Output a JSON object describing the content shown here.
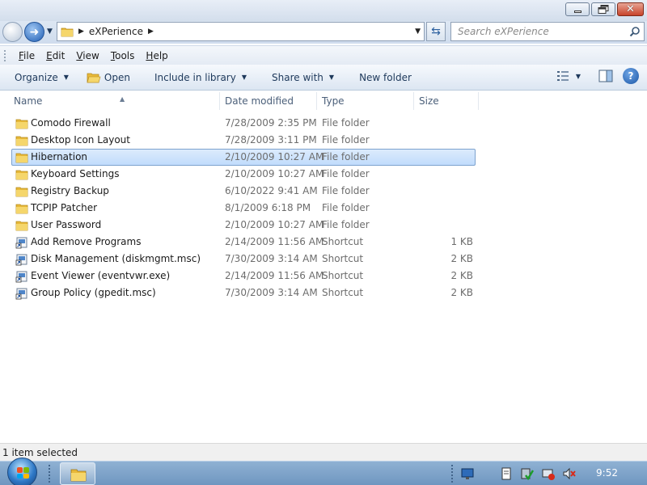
{
  "window": {
    "buttons": {
      "minimize": "minimize",
      "maximize": "maximize",
      "close": "close"
    }
  },
  "address": {
    "path": [
      "eXPerience"
    ],
    "search_placeholder": "Search eXPerience"
  },
  "menu": {
    "items": [
      {
        "label": "File",
        "underline": "F",
        "rest": "ile"
      },
      {
        "label": "Edit",
        "underline": "E",
        "rest": "dit"
      },
      {
        "label": "View",
        "underline": "V",
        "rest": "iew"
      },
      {
        "label": "Tools",
        "underline": "T",
        "rest": "ools"
      },
      {
        "label": "Help",
        "underline": "H",
        "rest": "elp"
      }
    ]
  },
  "commands": {
    "organize": "Organize",
    "open": "Open",
    "include_in_library": "Include in library",
    "share_with": "Share with",
    "new_folder": "New folder"
  },
  "columns": {
    "name": "Name",
    "date_modified": "Date modified",
    "type": "Type",
    "size": "Size"
  },
  "files": [
    {
      "name": "Comodo Firewall",
      "date": "7/28/2009 2:35 PM",
      "type": "File folder",
      "size": "",
      "icon": "folder-icon",
      "selected": false
    },
    {
      "name": "Desktop Icon Layout",
      "date": "7/28/2009 3:11 PM",
      "type": "File folder",
      "size": "",
      "icon": "folder-icon",
      "selected": false
    },
    {
      "name": "Hibernation",
      "date": "2/10/2009 10:27 AM",
      "type": "File folder",
      "size": "",
      "icon": "folder-icon",
      "selected": true
    },
    {
      "name": "Keyboard Settings",
      "date": "2/10/2009 10:27 AM",
      "type": "File folder",
      "size": "",
      "icon": "folder-icon",
      "selected": false
    },
    {
      "name": "Registry Backup",
      "date": "6/10/2022 9:41 AM",
      "type": "File folder",
      "size": "",
      "icon": "folder-icon",
      "selected": false
    },
    {
      "name": "TCPIP Patcher",
      "date": "8/1/2009 6:18 PM",
      "type": "File folder",
      "size": "",
      "icon": "folder-icon",
      "selected": false
    },
    {
      "name": "User Password",
      "date": "2/10/2009 10:27 AM",
      "type": "File folder",
      "size": "",
      "icon": "folder-icon",
      "selected": false
    },
    {
      "name": "Add Remove Programs",
      "date": "2/14/2009 11:56 AM",
      "type": "Shortcut",
      "size": "1 KB",
      "icon": "shortcut-icon",
      "selected": false
    },
    {
      "name": "Disk Management (diskmgmt.msc)",
      "date": "7/30/2009 3:14 AM",
      "type": "Shortcut",
      "size": "2 KB",
      "icon": "shortcut-icon",
      "selected": false
    },
    {
      "name": "Event Viewer (eventvwr.exe)",
      "date": "2/14/2009 11:56 AM",
      "type": "Shortcut",
      "size": "2 KB",
      "icon": "shortcut-icon",
      "selected": false
    },
    {
      "name": "Group Policy (gpedit.msc)",
      "date": "7/30/2009 3:14 AM",
      "type": "Shortcut",
      "size": "2 KB",
      "icon": "shortcut-icon",
      "selected": false
    }
  ],
  "status": {
    "text": "1 item selected"
  },
  "taskbar": {
    "clock": "9:52",
    "tray_icons": [
      "monitor-icon",
      "notepad-icon",
      "security-shield-icon",
      "network-icon",
      "volume-muted-icon"
    ]
  },
  "colors": {
    "selection_bg": "#c9e0fc",
    "selection_border": "#7da2ce",
    "taskbar": "#7fa4ca",
    "folder": "#e8b93a"
  }
}
